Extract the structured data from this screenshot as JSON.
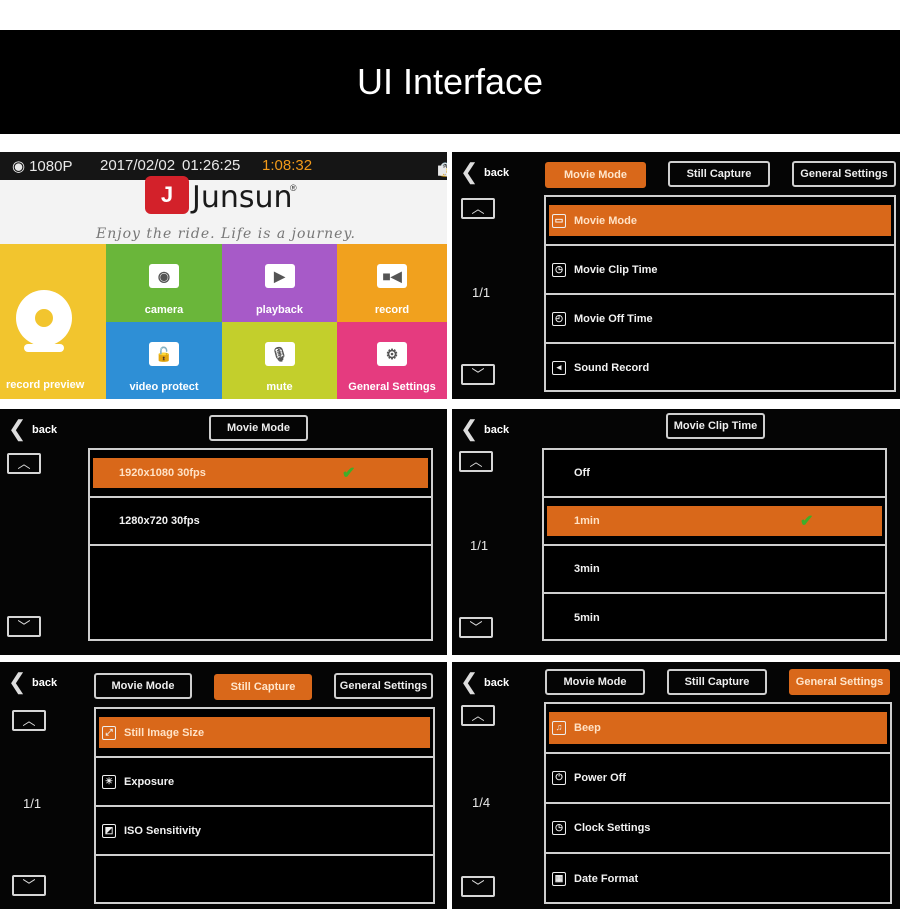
{
  "banner": {
    "title": "UI Interface"
  },
  "home": {
    "status": {
      "resolution": "1080P",
      "date": "2017/02/02",
      "time": "01:26:25",
      "elapsed": "1:08:32"
    },
    "brand": {
      "name": "Junsun",
      "registered": "®",
      "slogan": "Enjoy the ride. Life is a journey."
    },
    "tiles": {
      "record_preview": "record preview",
      "camera": "camera",
      "playback": "playback",
      "record": "record",
      "video_protect": "video protect",
      "mute": "mute",
      "general_settings": "General Settings"
    },
    "colors": {
      "preview": "#f2c52e",
      "camera": "#6ab63a",
      "playback": "#a75ac8",
      "record": "#f1a11e",
      "video_protect": "#2e8fd6",
      "mute": "#c3cf2c",
      "general_settings": "#e53b7f"
    }
  },
  "movie_menu": {
    "back": "back",
    "tabs": [
      "Movie Mode",
      "Still Capture",
      "General Settings"
    ],
    "active_tab": "Movie Mode",
    "page": "1/1",
    "items": [
      {
        "label": "Movie Mode",
        "icon": "movie-icon"
      },
      {
        "label": "Movie Clip Time",
        "icon": "clip-time-icon"
      },
      {
        "label": "Movie Off Time",
        "icon": "timer-icon"
      },
      {
        "label": "Sound Record",
        "icon": "speaker-icon"
      }
    ]
  },
  "movie_mode": {
    "back": "back",
    "title": "Movie Mode",
    "options": [
      "1920x1080 30fps",
      "1280x720 30fps"
    ],
    "selected": "1920x1080 30fps"
  },
  "clip_time": {
    "back": "back",
    "title": "Movie Clip Time",
    "page": "1/1",
    "options": [
      "Off",
      "1min",
      "3min",
      "5min"
    ],
    "selected": "1min"
  },
  "still_menu": {
    "back": "back",
    "tabs": [
      "Movie Mode",
      "Still Capture",
      "General Settings"
    ],
    "active_tab": "Still Capture",
    "page": "1/1",
    "items": [
      {
        "label": "Still Image Size",
        "icon": "image-size-icon"
      },
      {
        "label": "Exposure",
        "icon": "exposure-icon"
      },
      {
        "label": "ISO Sensitivity",
        "icon": "iso-icon"
      }
    ]
  },
  "general_menu": {
    "back": "back",
    "tabs": [
      "Movie Mode",
      "Still Capture",
      "General Settings"
    ],
    "active_tab": "General Settings",
    "page": "1/4",
    "items": [
      {
        "label": "Beep",
        "icon": "music-note-icon"
      },
      {
        "label": "Power Off",
        "icon": "power-icon"
      },
      {
        "label": "Clock Settings",
        "icon": "clock-icon"
      },
      {
        "label": "Date Format",
        "icon": "calendar-icon"
      }
    ]
  },
  "accent_color": "#d9681a",
  "check_color": "#3fae2a"
}
